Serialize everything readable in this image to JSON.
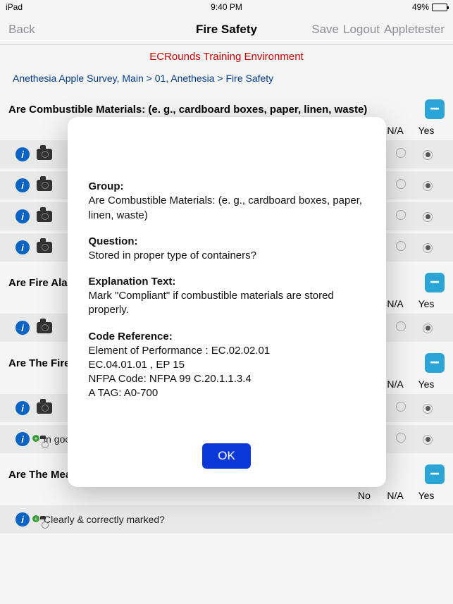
{
  "status_bar": {
    "device": "iPad",
    "time": "9:40 PM",
    "battery_pct": "49%"
  },
  "nav": {
    "back": "Back",
    "title": "Fire Safety",
    "save": "Save",
    "logout": "Logout",
    "user": "Appletester"
  },
  "training_banner": "ECRounds Training Environment",
  "breadcrumb": "Anethesia Apple Survey, Main > 01, Anethesia > Fire Safety",
  "cols": {
    "no": "No",
    "na": "N/A",
    "yes": "Yes"
  },
  "sections": [
    {
      "title": "Are Combustible Materials: (e. g., cardboard  boxes, paper, linen, waste)",
      "headers": [
        "N/A",
        "Yes"
      ],
      "rows": [
        {
          "text": "",
          "na": false,
          "yes": true
        },
        {
          "text": "",
          "na": false,
          "yes": true
        },
        {
          "text": "",
          "na": false,
          "yes": true
        },
        {
          "text": "",
          "na": false,
          "yes": true
        }
      ]
    },
    {
      "title": "Are Fire Alar",
      "headers": [
        "N/A",
        "Yes"
      ],
      "rows": [
        {
          "text": "",
          "na": false,
          "yes": true
        }
      ]
    },
    {
      "title": "Are The Fire",
      "headers": [
        "N/A",
        "Yes"
      ],
      "rows": [
        {
          "text": "",
          "na": false,
          "yes": true
        },
        {
          "text": "in good condition (i. e., glass bar in place)?",
          "na": false,
          "yes": true,
          "has_note": true,
          "camera_add": true
        }
      ]
    },
    {
      "title": "Are The Means Of Egress/Exit Doors",
      "headers": [
        "No",
        "N/A",
        "Yes"
      ],
      "rows": [
        {
          "text": "Clearly & correctly marked?",
          "camera_add": true
        }
      ]
    }
  ],
  "modal": {
    "group_label": "Group:",
    "group": "Are Combustible Materials: (e. g., cardboard  boxes, paper, linen, waste)",
    "question_label": "Question:",
    "question": "Stored in proper type of containers?",
    "explanation_label": "Explanation Text:",
    "explanation": "Mark \"Compliant\" if combustible materials are stored properly.",
    "code_ref_label": "Code Reference:",
    "code_ref": "Element of Performance : EC.02.02.01\nEC.04.01.01 , EP 15\nNFPA Code: NFPA 99 C.20.1.1.3.4\nA TAG: A0-700",
    "ok": "OK"
  }
}
